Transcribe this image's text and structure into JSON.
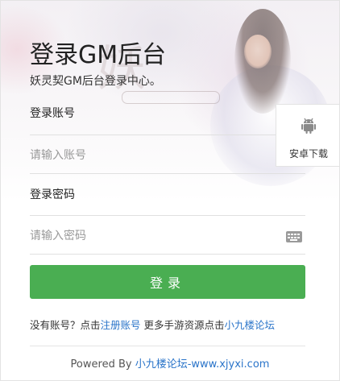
{
  "header": {
    "title": "登录GM后台",
    "subtitle": "妖灵契GM后台登录中心。"
  },
  "form": {
    "username_label": "登录账号",
    "username_placeholder": "请输入账号",
    "password_label": "登录密码",
    "password_placeholder": "请输入密码",
    "submit_label": "登录"
  },
  "side_tab": {
    "label": "安卓下载",
    "icon": "android-icon"
  },
  "register": {
    "prefix": "没有账号？点击",
    "link": "注册账号",
    "middle": "更多手游资源点击",
    "forum_link": "小九楼论坛"
  },
  "footer": {
    "powered_by": "Powered By",
    "link": "小九楼论坛-www.xjyxi.com"
  },
  "colors": {
    "accent": "#4aae52",
    "link": "#2a74c9"
  }
}
